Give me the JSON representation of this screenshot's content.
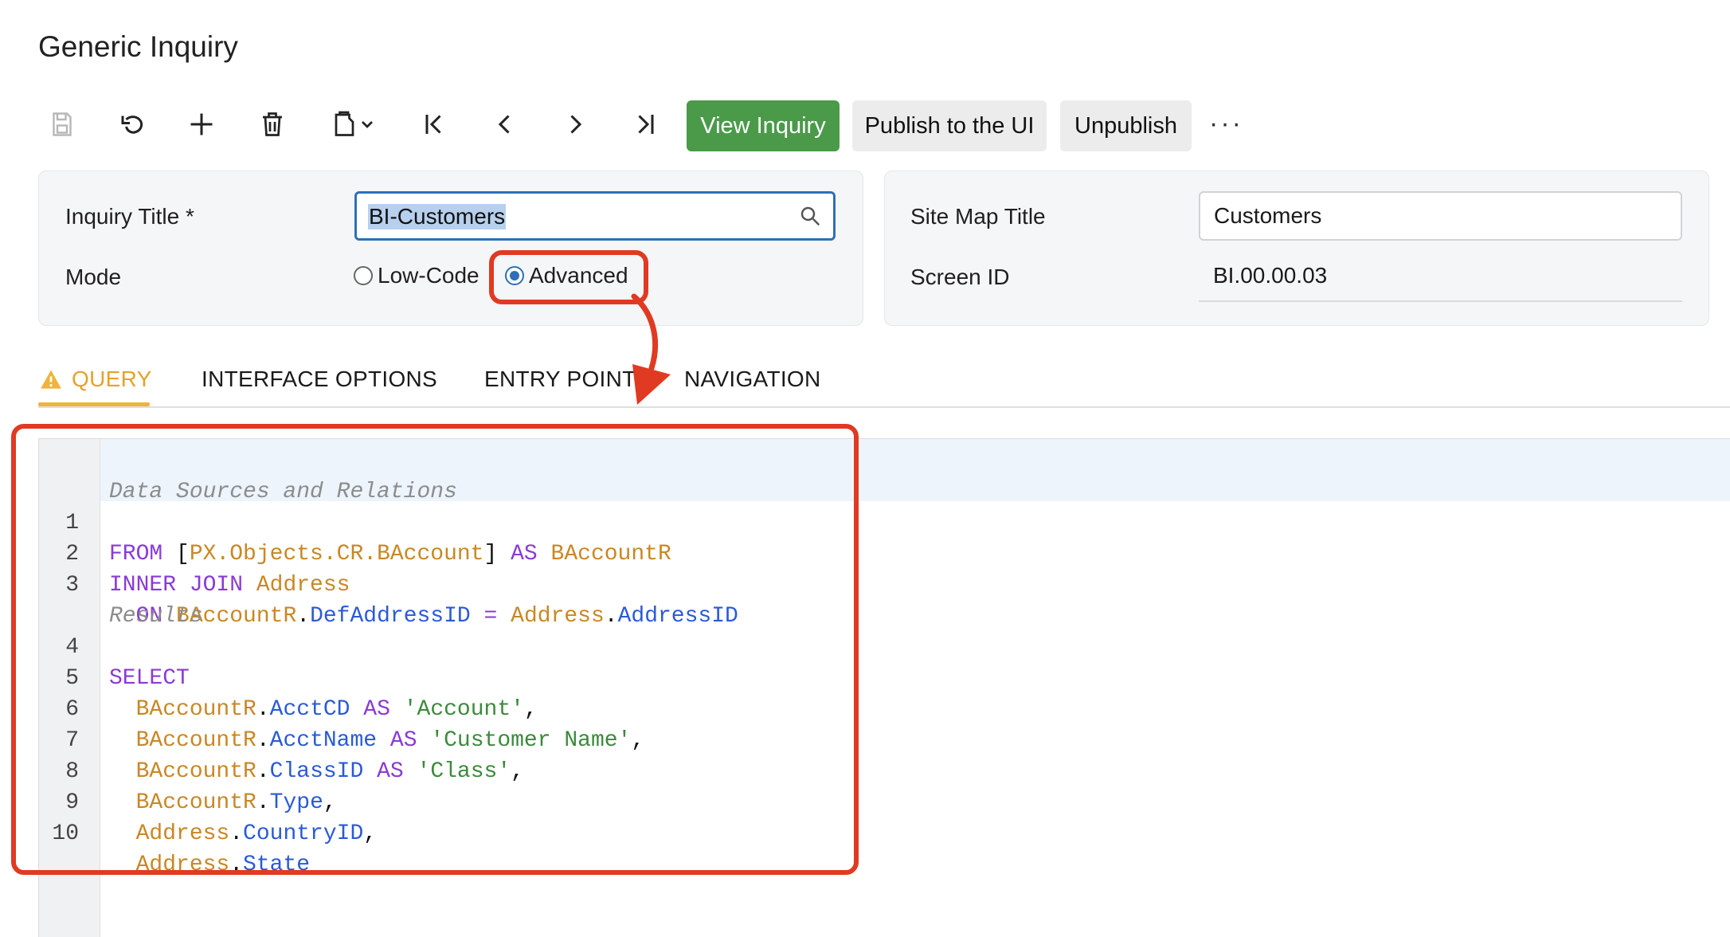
{
  "page": {
    "title": "Generic Inquiry"
  },
  "toolbar": {
    "icons": [
      "save-icon",
      "undo-icon",
      "add-icon",
      "delete-icon",
      "copy-paste-icon",
      "first-record-icon",
      "previous-record-icon",
      "next-record-icon",
      "last-record-icon"
    ],
    "view_inquiry_label": "View Inquiry",
    "publish_label": "Publish to the UI",
    "unpublish_label": "Unpublish",
    "more_label": "···"
  },
  "form": {
    "inquiry_title_label": "Inquiry Title *",
    "inquiry_title_value": "BI-Customers",
    "mode_label": "Mode",
    "mode_options": [
      "Low-Code",
      "Advanced"
    ],
    "mode_selected": "Advanced",
    "site_map_title_label": "Site Map Title",
    "site_map_title_value": "Customers",
    "screen_id_label": "Screen ID",
    "screen_id_value": "BI.00.00.03"
  },
  "tabs": [
    {
      "label": "QUERY",
      "active": true,
      "warning": true
    },
    {
      "label": "INTERFACE OPTIONS",
      "active": false
    },
    {
      "label": "ENTRY POINT",
      "active": false
    },
    {
      "label": "NAVIGATION",
      "active": false
    }
  ],
  "editor": {
    "section_sources": "Data Sources and Relations",
    "section_results": "Results",
    "line_numbers": [
      "1",
      "2",
      "3",
      "4",
      "5",
      "6",
      "7",
      "8",
      "9",
      "10"
    ]
  },
  "colors": {
    "primary_button": "#4a9a4a",
    "tab_active": "#e6a12a",
    "annotation": "#e03a22",
    "keyword": "#8a3ad6",
    "table_ref": "#c98724",
    "field": "#2a5ad6",
    "string": "#3b8a3b"
  }
}
